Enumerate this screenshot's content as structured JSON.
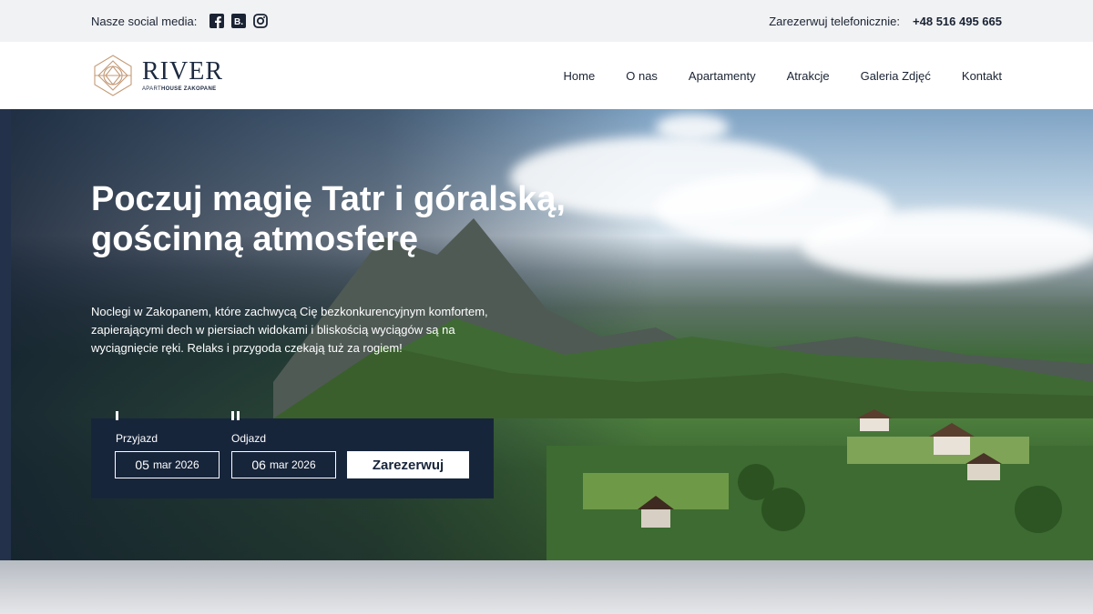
{
  "topbar": {
    "social_label": "Nasze social media:",
    "icons": [
      "facebook-icon",
      "booking-icon",
      "instagram-icon"
    ],
    "booking_glyph": "B.",
    "reserve_label": "Zarezerwuj telefonicznie:",
    "phone": "+48 516 495 665"
  },
  "header": {
    "logo": {
      "name": "RIVER",
      "sub_prefix": "APART",
      "sub_bold": "HOUSE ZAKOPANE"
    },
    "nav": [
      "Home",
      "O nas",
      "Apartamenty",
      "Atrakcje",
      "Galeria Zdjęć",
      "Kontakt"
    ]
  },
  "hero": {
    "title": "Poczuj magię Tatr i góralską, gościnną atmosferę",
    "description": "Noclegi w Zakopanem, które zachwycą Cię bezkonkurencyjnym komfortem, zapierającymi dech w piersiach widokami i bliskością wyciągów są na wyciągnięcie ręki. Relaks i przygoda czekają tuż za rogiem!"
  },
  "booking": {
    "arrival_label": "Przyjazd",
    "arrival_day": "05",
    "arrival_month_year": "mar 2026",
    "departure_label": "Odjazd",
    "departure_day": "06",
    "departure_month_year": "mar 2026",
    "submit_label": "Zarezerwuj"
  },
  "colors": {
    "navy": "#17253b",
    "topbar_bg": "#f1f2f4"
  }
}
